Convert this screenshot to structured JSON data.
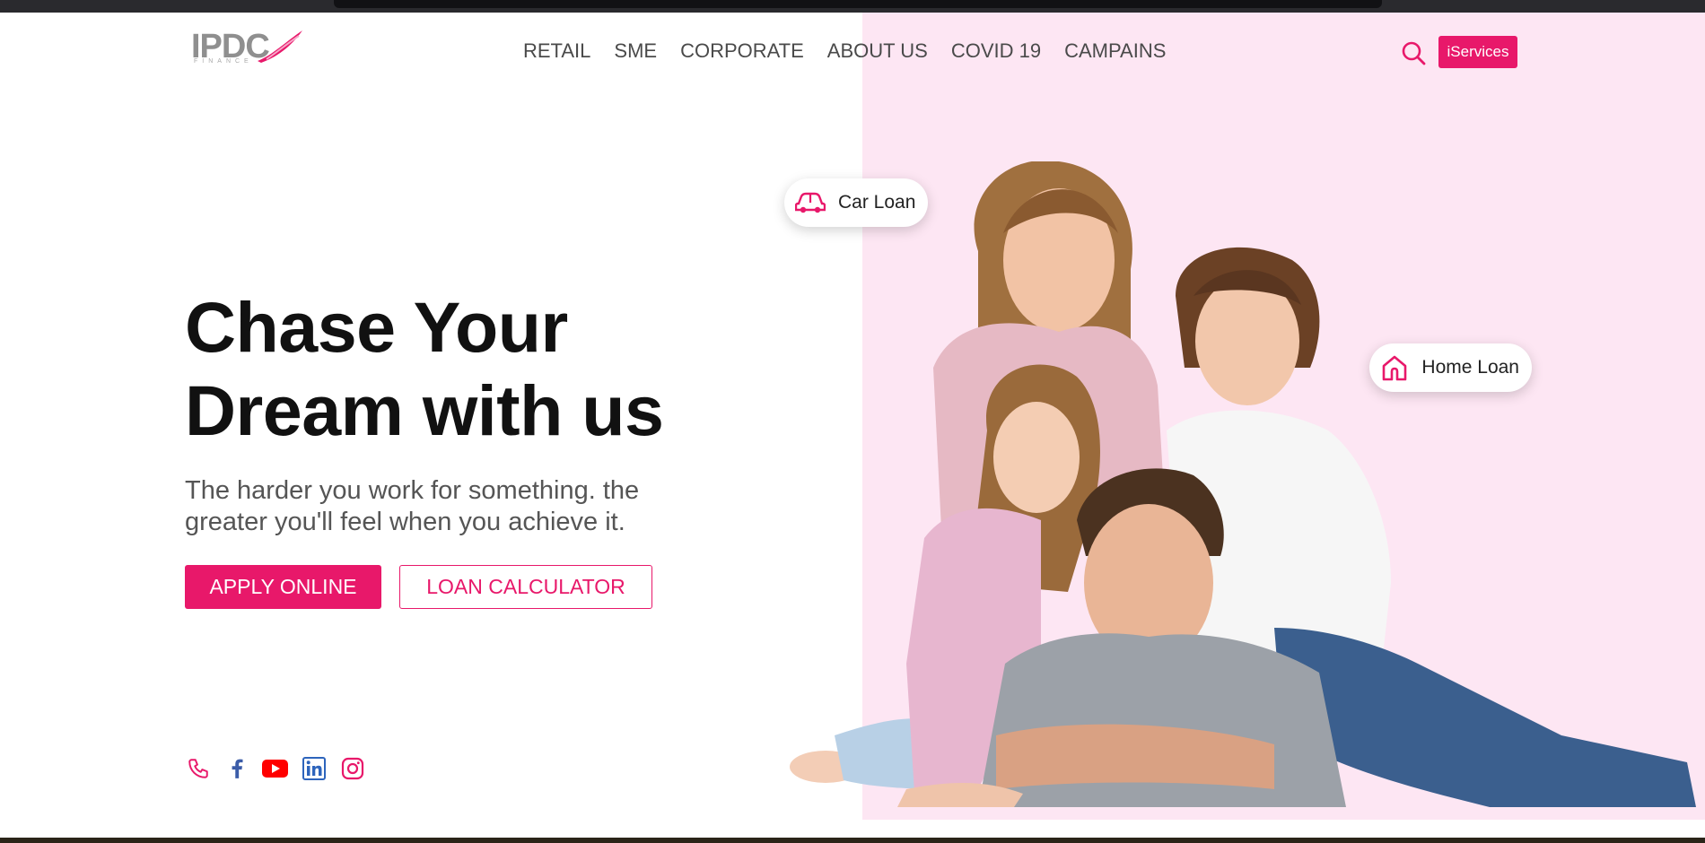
{
  "brand": {
    "logo_text": "IPDC",
    "logo_subtext": "FINANCE"
  },
  "nav": {
    "items": [
      {
        "label": "RETAIL"
      },
      {
        "label": "SME"
      },
      {
        "label": "CORPORATE"
      },
      {
        "label": "ABOUT US"
      },
      {
        "label": "COVID 19"
      },
      {
        "label": "CAMPAINS"
      }
    ],
    "search_icon": "search-icon",
    "iservices_label": "iServices"
  },
  "hero": {
    "headline_line1": "Chase Your",
    "headline_line2": "Dream with us",
    "subline": "The harder you work for something. the greater you'll feel when you achieve it.",
    "apply_label": "APPLY ONLINE",
    "calculator_label": "LOAN CALCULATOR"
  },
  "pills": {
    "car_loan": {
      "label": "Car Loan",
      "icon": "car-icon"
    },
    "home_loan": {
      "label": "Home Loan",
      "icon": "home-icon"
    }
  },
  "social": [
    "phone-icon",
    "facebook-icon",
    "youtube-icon",
    "linkedin-icon",
    "instagram-icon"
  ],
  "colors": {
    "accent": "#e8186a",
    "panel": "#fde6f3",
    "text_dark": "#111111",
    "text_muted": "#555555"
  }
}
